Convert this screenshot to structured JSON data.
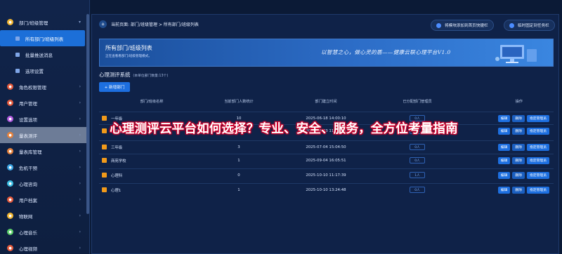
{
  "sidebar": {
    "items": [
      {
        "label": "部门/班级管理",
        "icon": "building-icon",
        "color": "#f2b632",
        "type": "parent"
      },
      {
        "label": "所有部门/班级列表",
        "type": "sub",
        "active": true
      },
      {
        "label": "批量推送消息",
        "type": "sub"
      },
      {
        "label": "选项设置",
        "type": "sub"
      },
      {
        "label": "角色权限管理",
        "icon": "role-icon",
        "color": "#e55a3c",
        "type": "parent"
      },
      {
        "label": "用户管理",
        "icon": "user-icon",
        "color": "#e55a3c",
        "type": "parent"
      },
      {
        "label": "设置选项",
        "icon": "settings-icon",
        "color": "#b45ce0",
        "type": "parent"
      },
      {
        "label": "量表测评",
        "icon": "scale-icon",
        "color": "#e5813c",
        "type": "parent"
      },
      {
        "label": "量表库管理",
        "icon": "library-icon",
        "color": "#e5813c",
        "type": "parent"
      },
      {
        "label": "危机干预",
        "icon": "alert-icon",
        "color": "#3ca6e5",
        "type": "parent"
      },
      {
        "label": "心理咨询",
        "icon": "consult-icon",
        "color": "#3cc0e5",
        "type": "parent"
      },
      {
        "label": "用户档案",
        "icon": "archive-icon",
        "color": "#e55a3c",
        "type": "parent"
      },
      {
        "label": "物联网",
        "icon": "iot-icon",
        "color": "#f2b632",
        "type": "parent"
      },
      {
        "label": "心理音乐",
        "icon": "music-icon",
        "color": "#5ccf6a",
        "type": "parent"
      },
      {
        "label": "心理视频",
        "icon": "video-icon",
        "color": "#e55a3c",
        "type": "parent"
      }
    ]
  },
  "breadcrumb": "当前页面: 部门/班级管理 > 所有部门/班级列表",
  "top_buttons": [
    "将模块添加到首页快捷栏",
    "临时固定到任务栏"
  ],
  "banner": {
    "title": "所有部门/班级列表",
    "subtitle": "正在查看看部门/班级管理模式。",
    "slogan": "以智慧之心，做心灵的盾——健康云联心理平台V1.0"
  },
  "section": {
    "title": "心理测评系统",
    "count_note": "(本单位部门数量:13个)"
  },
  "add_button": "+ 新增部门",
  "table": {
    "headers": [
      "部门/班级名称",
      "当前部门人数统计",
      "部门建立时间",
      "已分配部门管理员",
      "操作"
    ],
    "rows": [
      {
        "name": "一年级",
        "count": "10",
        "time": "2025-06-18 14:00:10",
        "mgr": "0人"
      },
      {
        "name": "二年级",
        "count": "1",
        "time": "2025-06-23 11:51:33",
        "mgr": "0人"
      },
      {
        "name": "三年级",
        "count": "3",
        "time": "2025-07-04 15:04:50",
        "mgr": "0人"
      },
      {
        "name": "商苑学校",
        "count": "1",
        "time": "2025-09-04 16:05:51",
        "mgr": "0人"
      },
      {
        "name": "心理科",
        "count": "0",
        "time": "2025-10-10 11:17:39",
        "mgr": "1人"
      },
      {
        "name": "心理1",
        "count": "1",
        "time": "2025-10-10 13:24:48",
        "mgr": "0人"
      }
    ],
    "ops": [
      "编辑",
      "删除",
      "指定管理员"
    ]
  },
  "overlay_title": "心理测评云平台如何选择？专业、安全、服务，全方位考量指南"
}
